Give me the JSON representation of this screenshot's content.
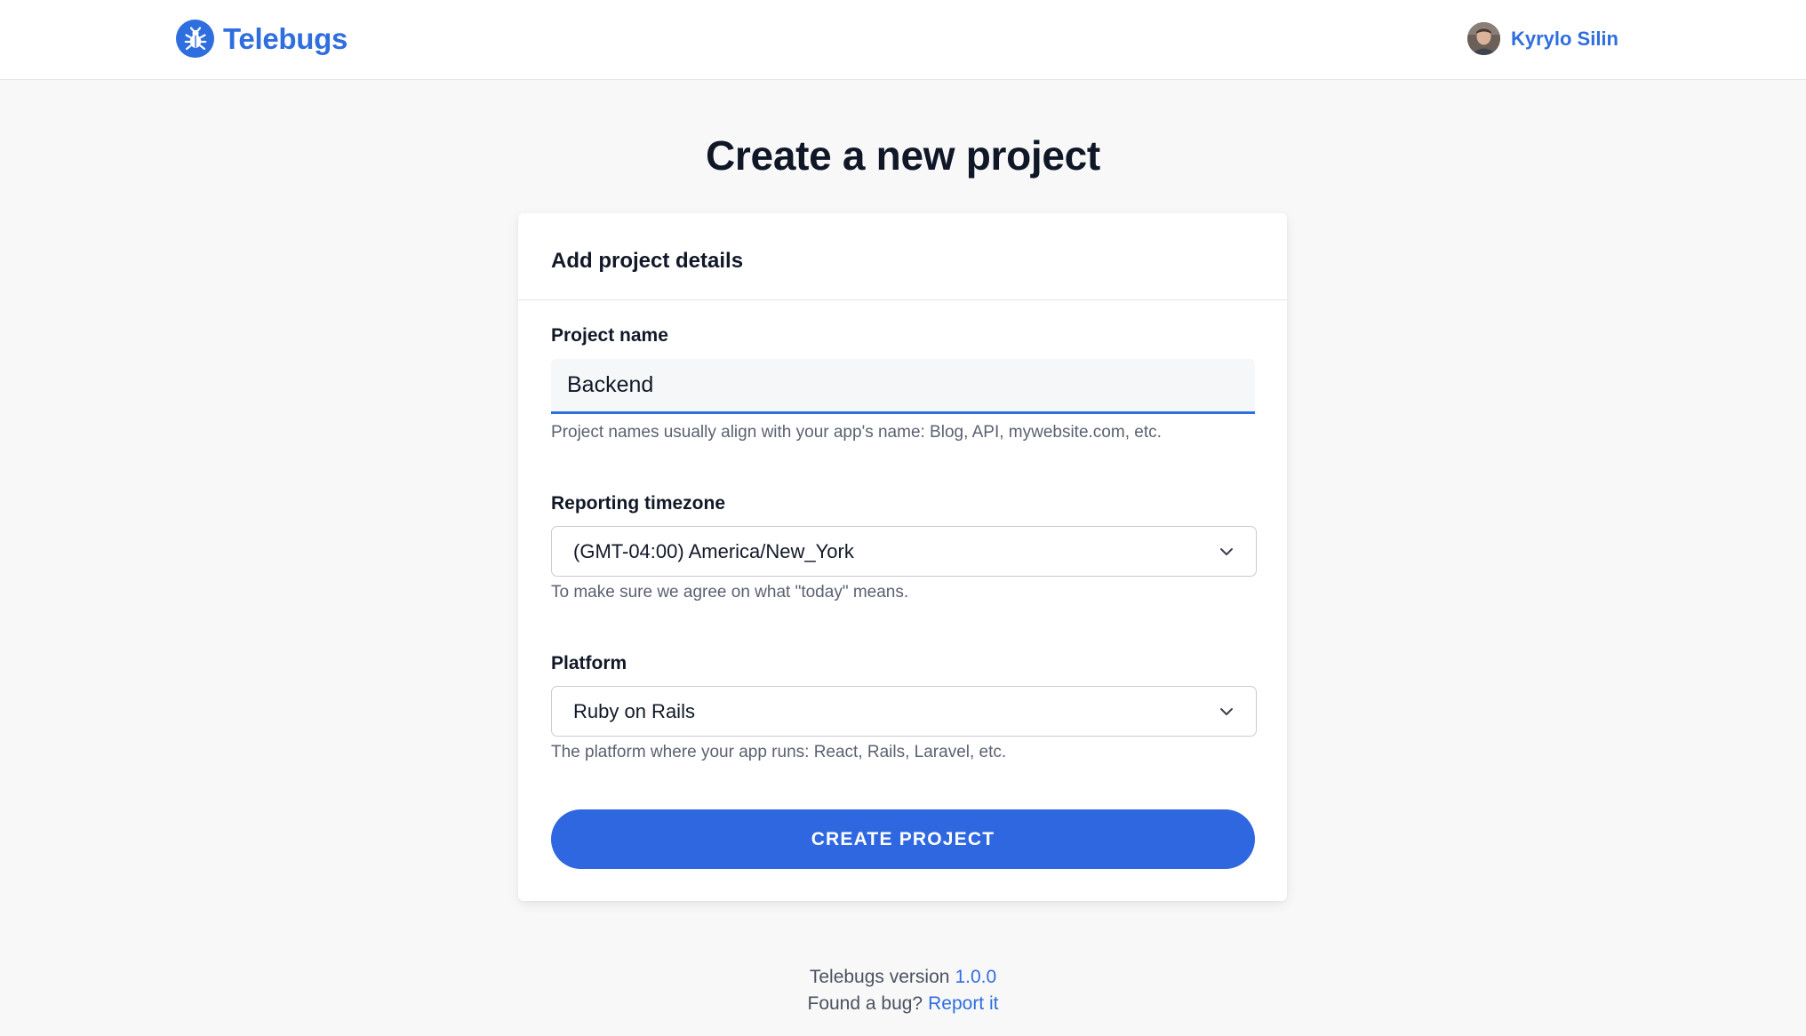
{
  "header": {
    "brand_name": "Telebugs",
    "brand_icon": "bug-icon",
    "user_name": "Kyrylo Silin",
    "avatar_icon": "avatar"
  },
  "page": {
    "title": "Create a new project"
  },
  "form": {
    "card_title": "Add project details",
    "project_name": {
      "label": "Project name",
      "value": "Backend",
      "hint": "Project names usually align with your app's name: Blog, API, mywebsite.com, etc."
    },
    "timezone": {
      "label": "Reporting timezone",
      "selected": "(GMT-04:00) America/New_York",
      "hint": "To make sure we agree on what \"today\" means.",
      "icon": "chevron-down-icon"
    },
    "platform": {
      "label": "Platform",
      "selected": "Ruby on Rails",
      "hint": "The platform where your app runs: React, Rails, Laravel, etc.",
      "icon": "chevron-down-icon"
    },
    "submit_label": "CREATE PROJECT"
  },
  "footer": {
    "version_text": "Telebugs version",
    "version_link": "1.0.0",
    "bug_text": "Found a bug?",
    "bug_link": "Report it"
  },
  "colors": {
    "accent": "#2f6ede",
    "button": "#2f67e0",
    "background": "#f8f8f9"
  }
}
